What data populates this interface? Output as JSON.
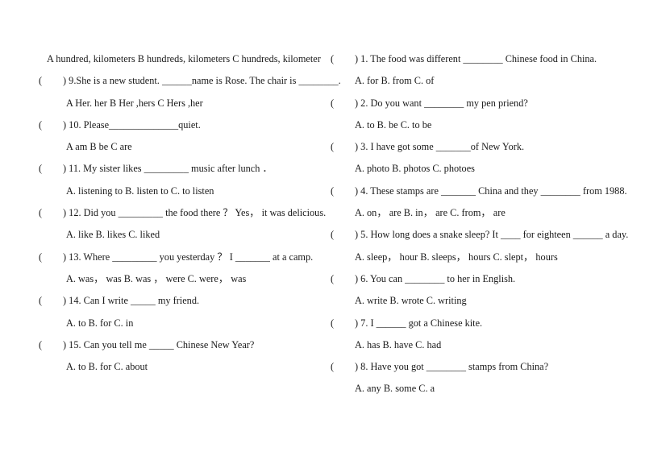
{
  "document": {
    "type": "multiple-choice-worksheet",
    "background_color": "#ffffff",
    "text_color": "#1a1a1a"
  },
  "left_column": {
    "lead_line": "A hundred, kilometers    B hundreds, kilometers C hundreds, kilometer",
    "items": [
      {
        "number": "9",
        "paren_open": "(",
        "paren_close": ")",
        "question": ") 9.She is a new student. ______name is Rose. The chair is ________.",
        "options_line": "A Her. her                    B Her ,hers              C Hers ,her"
      },
      {
        "number": "10",
        "paren_open": "(",
        "paren_close": ")",
        "question": ") 10. Please______________quiet.",
        "options_line": "A am                              B be                              C are"
      },
      {
        "number": "11",
        "paren_open": "(",
        "paren_close": ")",
        "question": ") 11. My sister likes _________ music after lunch ．",
        "options_line": "A. listening to    B. listen to    C. to listen"
      },
      {
        "number": "12",
        "paren_open": "(",
        "paren_close": ")",
        "question": ") 12. Did you _________ the food there ？ Yes，  it was delicious.",
        "options_line": "A. like               B. likes             C. liked"
      },
      {
        "number": "13",
        "paren_open": "(",
        "paren_close": ")",
        "question": ") 13. Where _________ you yesterday ？ I _______ at a camp.",
        "options_line": "A. was，   was     B. was ，   were   C. were，   was"
      },
      {
        "number": "14",
        "paren_open": "(",
        "paren_close": ")",
        "question": ") 14. Can I write _____ my friend.",
        "options_line": "A. to                  B. for                  C. in"
      },
      {
        "number": "15",
        "paren_open": "(",
        "paren_close": ")",
        "question": ") 15. Can you tell me _____ Chinese New Year?",
        "options_line": "A. to                  B. for                 C. about"
      }
    ]
  },
  "right_column": {
    "items": [
      {
        "number": "1",
        "paren_open": "(",
        "paren_close": ")",
        "question": ") 1. The food was different ________ Chinese food in China.",
        "options_line": "A. for                      B. from                    C. of"
      },
      {
        "number": "2",
        "paren_open": "(",
        "paren_close": ")",
        "question": ") 2. Do you want  ________ my pen priend?",
        "options_line": "A. to                       B. be                        C. to be"
      },
      {
        "number": "3",
        "paren_open": "(",
        "paren_close": ")",
        "question": ") 3. I have got some _______of New York.",
        "options_line": "A. photo                 B. photos              C. photoes"
      },
      {
        "number": "4",
        "paren_open": "(",
        "paren_close": ")",
        "question": ") 4. These stamps are _______ China and they ________ from 1988.",
        "options_line": "A. on，  are            B. in，  are           C. from，  are"
      },
      {
        "number": "5",
        "paren_open": "(",
        "paren_close": ")",
        "question": ") 5. How long does a snake sleep? It ____ for eighteen ______ a day.",
        "options_line": "A. sleep，  hour         B. sleeps，  hours   C. slept，  hours"
      },
      {
        "number": "6",
        "paren_open": "(",
        "paren_close": ")",
        "question": ") 6. You can ________ to her in English.",
        "options_line": "A. write                   B. wrote                 C. writing"
      },
      {
        "number": "7",
        "paren_open": "(",
        "paren_close": ")",
        "question": ") 7. I ______ got a Chinese kite.",
        "options_line": "A.   has                   B. have                         C. had"
      },
      {
        "number": "8",
        "paren_open": "(",
        "paren_close": ")",
        "question": ") 8. Have you got ________ stamps from China?",
        "options_line": "A. any                     B. some                   C. a"
      }
    ]
  }
}
